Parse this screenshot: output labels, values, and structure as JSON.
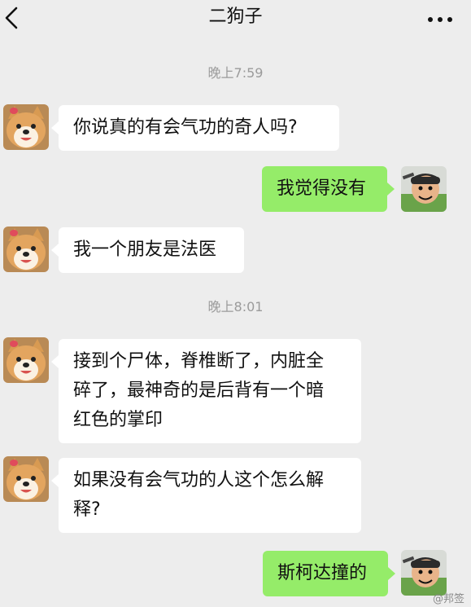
{
  "header": {
    "back_icon": "chevron-left-icon",
    "title": "二狗子",
    "more_icon": "more-dots-icon"
  },
  "colors": {
    "background": "#ededed",
    "received_bubble": "#ffffff",
    "sent_bubble": "#95ec69",
    "timestamp_text": "#9b9b9b"
  },
  "timestamps": [
    "晚上7:59",
    "晚上8:01"
  ],
  "messages": [
    {
      "side": "left",
      "avatar": "shiba-dog-avatar",
      "text": "你说真的有会气功的奇人吗?"
    },
    {
      "side": "right",
      "avatar": "cartoon-man-avatar",
      "text": "我觉得没有"
    },
    {
      "side": "left",
      "avatar": "shiba-dog-avatar",
      "text": "我一个朋友是法医"
    },
    {
      "side": "left",
      "avatar": "shiba-dog-avatar",
      "lines": [
        "接到个尸体，脊椎断了，内脏全",
        "碎了，最神奇的是后背有一个暗",
        "红色的掌印"
      ]
    },
    {
      "side": "left",
      "avatar": "shiba-dog-avatar",
      "lines": [
        "如果没有会气功的人这个怎么解",
        "释?"
      ]
    },
    {
      "side": "right",
      "avatar": "cartoon-man-avatar",
      "text": "斯柯达撞的"
    }
  ],
  "watermark": "@邦签"
}
